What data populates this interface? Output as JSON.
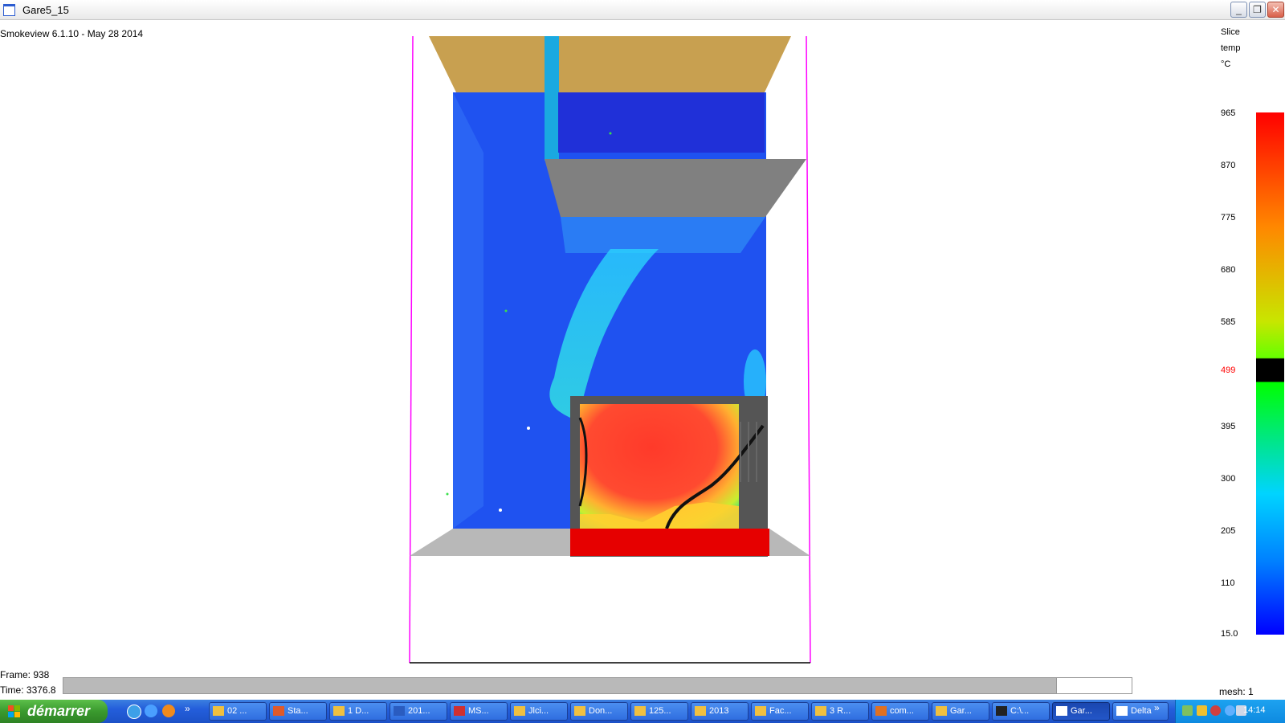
{
  "window": {
    "title": "Gare5_15",
    "minimize_glyph": "_",
    "restore_glyph": "❐",
    "close_glyph": "✕"
  },
  "viewer": {
    "app_info": "Smokeview 6.1.10 - May 28 2014",
    "frame_label": "Frame: 938",
    "time_label": "Time: 3376.8",
    "mesh_label": "mesh: 1",
    "time_progress": 0.93
  },
  "colorbar": {
    "title_line1": "Slice",
    "title_line2": "temp",
    "unit": "°C",
    "ticks": [
      "965",
      "870",
      "775",
      "680",
      "585",
      "499",
      "395",
      "300",
      "205",
      "110",
      "15.0"
    ],
    "highlight_tick": "499",
    "highlight_color": "#ff0000"
  },
  "taskbar": {
    "start_label": "démarrer",
    "quicklaunch_more": "»",
    "buttons": [
      "02 ...",
      "Sta...",
      "1 D...",
      "201...",
      "MS...",
      "Jlci...",
      "Don...",
      "125...",
      "2013",
      "Fac...",
      "3 R...",
      "com...",
      "Gar...",
      "C:\\...",
      "Gar...",
      "Delta"
    ],
    "overflow_glyph": "»",
    "clock": "14:14"
  },
  "colors": {
    "taskbar_blue": "#245edb",
    "start_green": "#3a9a2e",
    "tray_blue": "#0e8ae0",
    "domain_outline": "#ff00ff"
  }
}
